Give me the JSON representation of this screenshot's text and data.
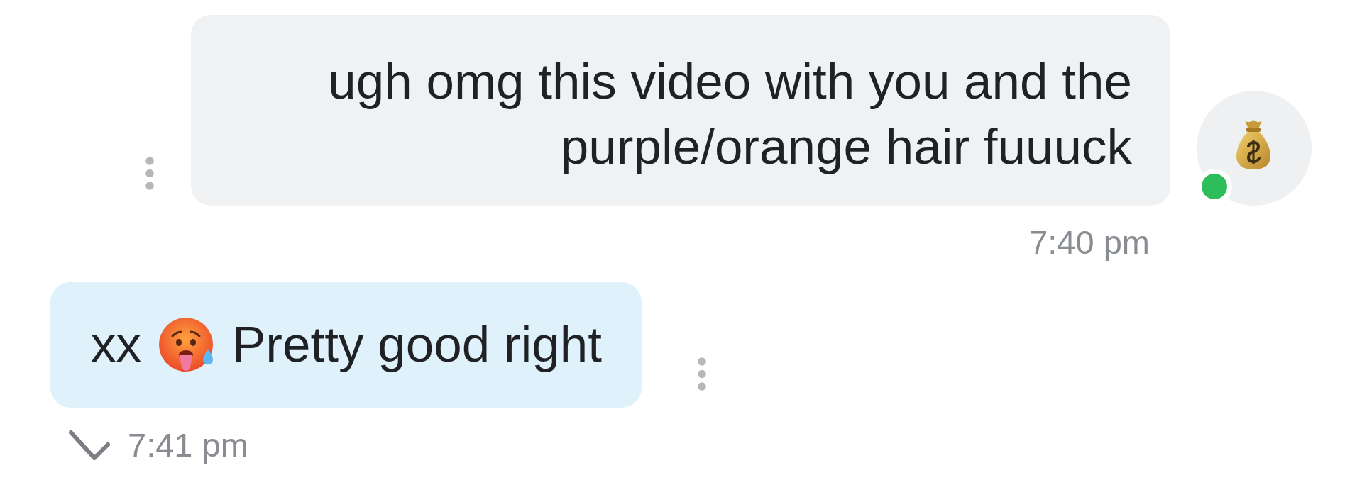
{
  "messages": [
    {
      "kind": "incoming",
      "avatar": {
        "online": true
      },
      "text": "ugh omg this video with you and the purple/orange hair fuuuck",
      "time": "7:40 pm"
    },
    {
      "kind": "outgoing",
      "parts": [
        {
          "kind": "text",
          "text": "xx"
        },
        {
          "kind": "emoji"
        },
        {
          "kind": "text",
          "text": "Pretty good right"
        }
      ],
      "time": "7:41 pm",
      "sent": true
    }
  ]
}
